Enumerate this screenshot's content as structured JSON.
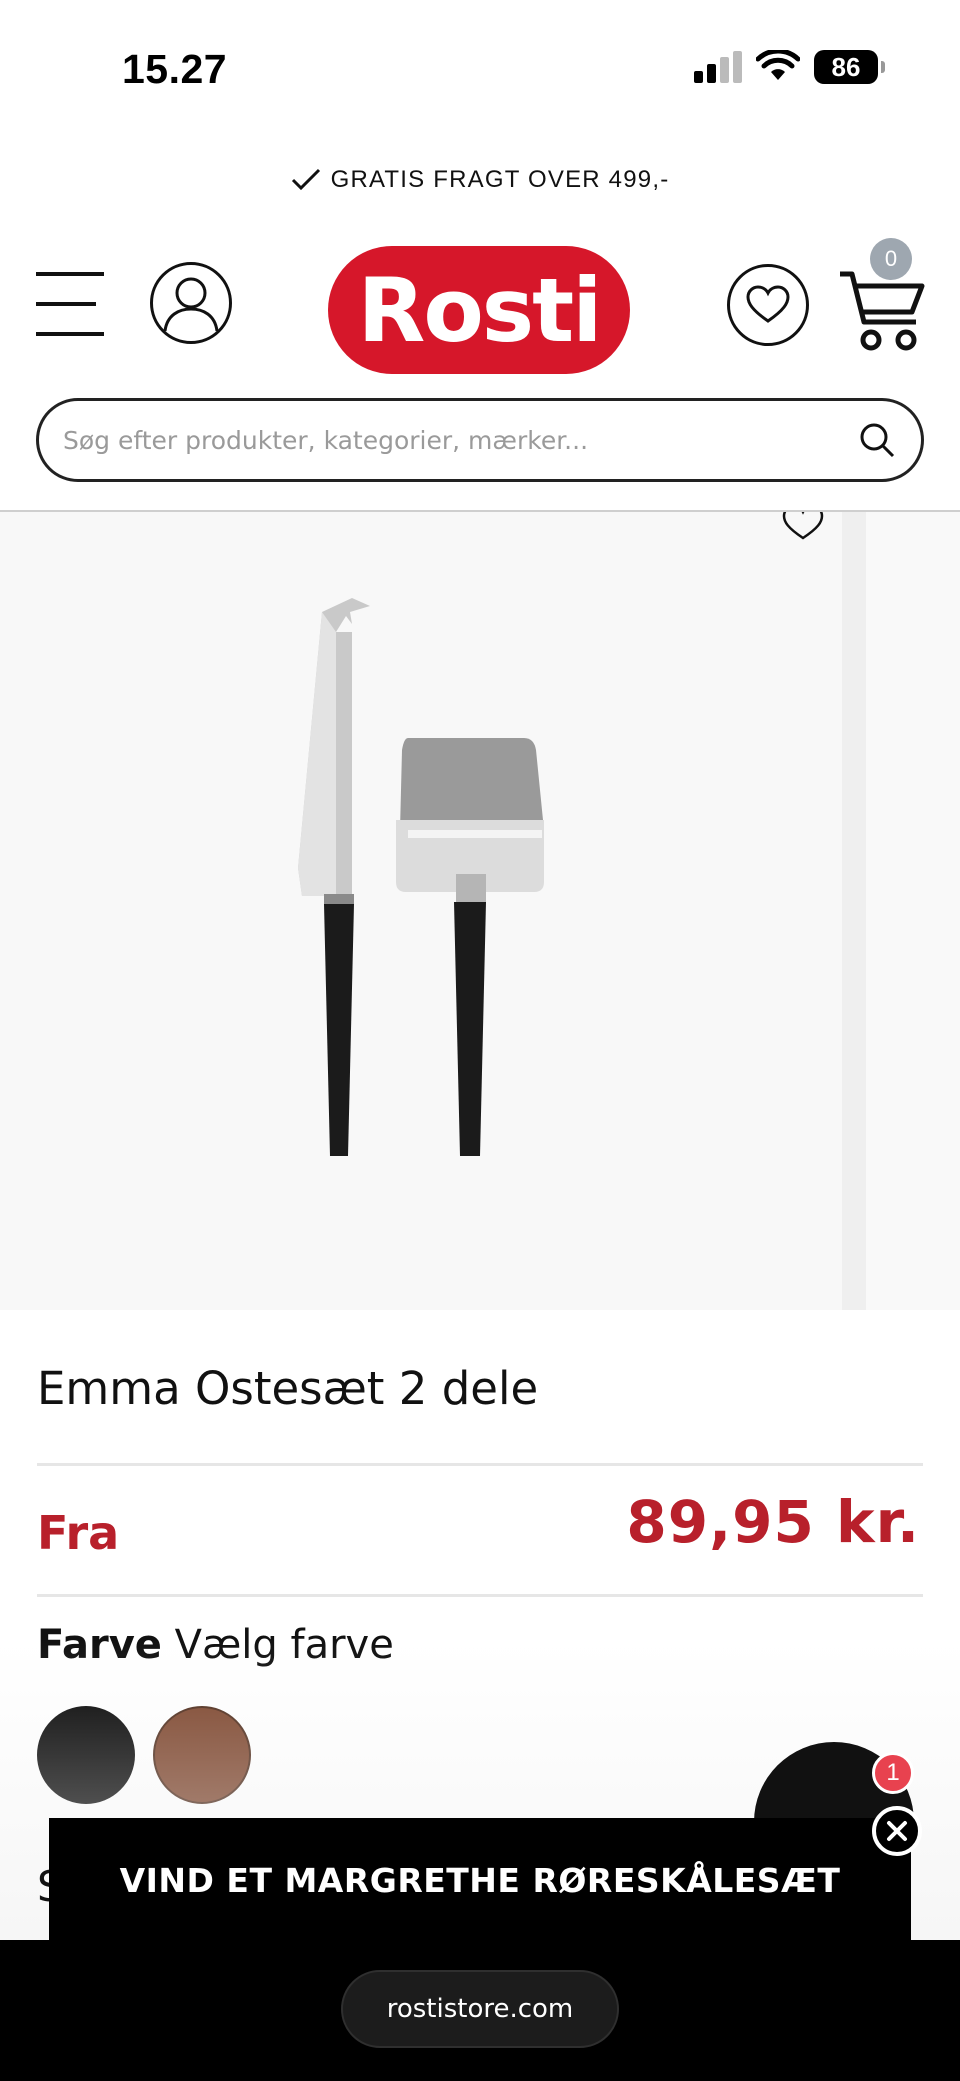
{
  "status_bar": {
    "time": "15.27",
    "battery": "86"
  },
  "promo": {
    "text": "GRATIS FRAGT OVER 499,-"
  },
  "header": {
    "logo": "Rosti",
    "cart_count": "0"
  },
  "search": {
    "placeholder": "Søg efter produkter, kategorier, mærker..."
  },
  "product": {
    "title": "Emma Ostesæt 2 dele",
    "price_prefix": "Fra",
    "price": "89,95 kr.",
    "color_label": "Farve",
    "color_value": "Vælg farve",
    "swatches": [
      {
        "name": "sort",
        "color": "#000000"
      },
      {
        "name": "brun",
        "color": "#7a4128"
      }
    ]
  },
  "chat": {
    "badge": "1"
  },
  "banner": {
    "text": "VIND ET MARGRETHE RØRESKÅLESÆT",
    "peek": "S"
  },
  "browser": {
    "url": "rostistore.com"
  },
  "colors": {
    "brand_red": "#d6172a",
    "price_red": "#b8202b"
  }
}
